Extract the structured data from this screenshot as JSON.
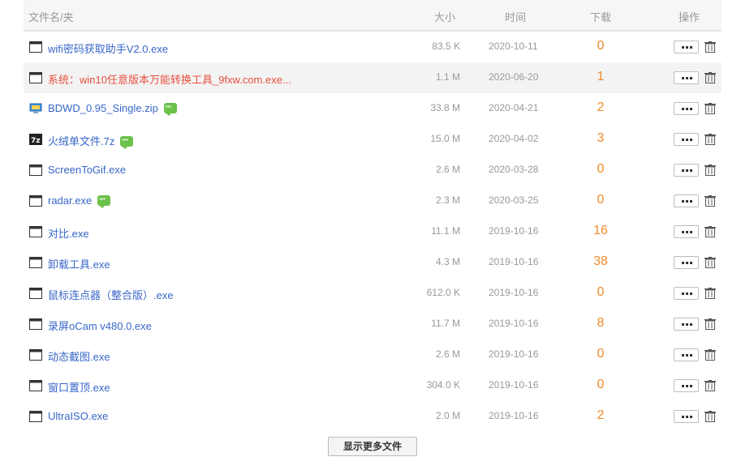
{
  "header": {
    "name": "文件名/夹",
    "size": "大小",
    "time": "时间",
    "downloads": "下载",
    "operate": "操作"
  },
  "files": [
    {
      "name": "wifi密码获取助手V2.0.exe",
      "size": "83.5 K",
      "time": "2020-10-11",
      "downloads": "0",
      "icon": "exe-icon",
      "comment": false
    },
    {
      "name": "系统：win10任意版本万能转换工具_9fxw.com.exe...",
      "size": "1.1 M",
      "time": "2020-06-20",
      "downloads": "1",
      "icon": "exe-icon",
      "comment": false
    },
    {
      "name": "BDWD_0.95_Single.zip",
      "size": "33.8 M",
      "time": "2020-04-21",
      "downloads": "2",
      "icon": "zip-icon",
      "comment": true
    },
    {
      "name": "火绒单文件.7z",
      "size": "15.0 M",
      "time": "2020-04-02",
      "downloads": "3",
      "icon": "7z-icon",
      "comment": true
    },
    {
      "name": "ScreenToGif.exe",
      "size": "2.6 M",
      "time": "2020-03-28",
      "downloads": "0",
      "icon": "exe-icon",
      "comment": false
    },
    {
      "name": "radar.exe",
      "size": "2.3 M",
      "time": "2020-03-25",
      "downloads": "0",
      "icon": "exe-icon",
      "comment": true
    },
    {
      "name": "对比.exe",
      "size": "11.1 M",
      "time": "2019-10-16",
      "downloads": "16",
      "icon": "exe-icon",
      "comment": false
    },
    {
      "name": "卸载工具.exe",
      "size": "4.3 M",
      "time": "2019-10-16",
      "downloads": "38",
      "icon": "exe-icon",
      "comment": false
    },
    {
      "name": "鼠标连点器（整合版）.exe",
      "size": "612.0 K",
      "time": "2019-10-16",
      "downloads": "0",
      "icon": "exe-icon",
      "comment": false
    },
    {
      "name": "录屏oCam v480.0.exe",
      "size": "11.7 M",
      "time": "2019-10-16",
      "downloads": "8",
      "icon": "exe-icon",
      "comment": false
    },
    {
      "name": "动态截图.exe",
      "size": "2.6 M",
      "time": "2019-10-16",
      "downloads": "0",
      "icon": "exe-icon",
      "comment": false
    },
    {
      "name": "窗口置顶.exe",
      "size": "304.0 K",
      "time": "2019-10-16",
      "downloads": "0",
      "icon": "exe-icon",
      "comment": false
    },
    {
      "name": "UltraISO.exe",
      "size": "2.0 M",
      "time": "2019-10-16",
      "downloads": "2",
      "icon": "exe-icon",
      "comment": false
    }
  ],
  "show_more_label": "显示更多文件",
  "colors": {
    "link": "#3867c8",
    "link_hover": "#e8503f",
    "downloads": "#f08a2a",
    "header_bg": "#f6f6f6",
    "comment_badge": "#6cc24a"
  }
}
